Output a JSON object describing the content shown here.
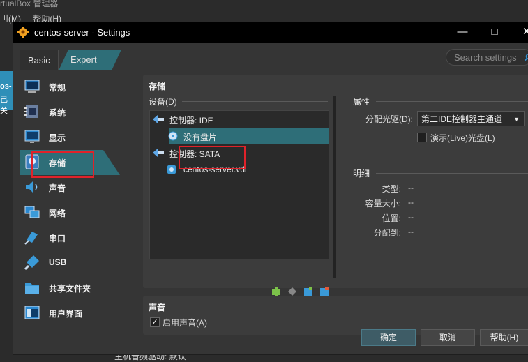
{
  "background_app": {
    "title": "rtualBox 管理器",
    "menu": [
      "刂(M)",
      "帮助(H)"
    ],
    "left_text": [
      "os-",
      "己关"
    ],
    "bottom_text": "主机音频驱动:   默认"
  },
  "window": {
    "title": "centos-server - Settings"
  },
  "mode_tabs": {
    "basic": "Basic",
    "expert": "Expert"
  },
  "search": {
    "placeholder": "Search settings"
  },
  "sidebar": {
    "items": [
      {
        "label": "常规",
        "icon": "monitor-icon"
      },
      {
        "label": "系统",
        "icon": "chip-icon"
      },
      {
        "label": "显示",
        "icon": "display-icon"
      },
      {
        "label": "存储",
        "icon": "storage-icon"
      },
      {
        "label": "声音",
        "icon": "speaker-icon"
      },
      {
        "label": "网络",
        "icon": "network-icon"
      },
      {
        "label": "串口",
        "icon": "serial-port-icon"
      },
      {
        "label": "USB",
        "icon": "usb-icon"
      },
      {
        "label": "共享文件夹",
        "icon": "folder-icon"
      },
      {
        "label": "用户界面",
        "icon": "ui-icon"
      }
    ],
    "active": "存储"
  },
  "storage": {
    "section_title": "存储",
    "devices_label": "设备(D)",
    "tree": {
      "controller_ide": "控制器: IDE",
      "ide_disc": "没有盘片",
      "controller_sata": "控制器: SATA",
      "sata_disk": "centos-server.vdi"
    },
    "attributes": {
      "title": "属性",
      "optical_drive_label": "分配光驱(D):",
      "optical_drive_value": "第二IDE控制器主通道",
      "live_cd_label": "演示(Live)光盘(L)"
    },
    "info": {
      "title": "明细",
      "rows": [
        {
          "key": "类型:",
          "value": "--"
        },
        {
          "key": "容量大小:",
          "value": "--"
        },
        {
          "key": "位置:",
          "value": "--"
        },
        {
          "key": "分配到:",
          "value": "--"
        }
      ]
    }
  },
  "audio": {
    "section_title": "声音",
    "enable_label": "启用声音(A)"
  },
  "buttons": {
    "ok": "确定",
    "cancel": "取消",
    "help": "帮助(H)"
  },
  "colors": {
    "accent": "#2e6e78",
    "highlight_box": "#e0222a"
  }
}
